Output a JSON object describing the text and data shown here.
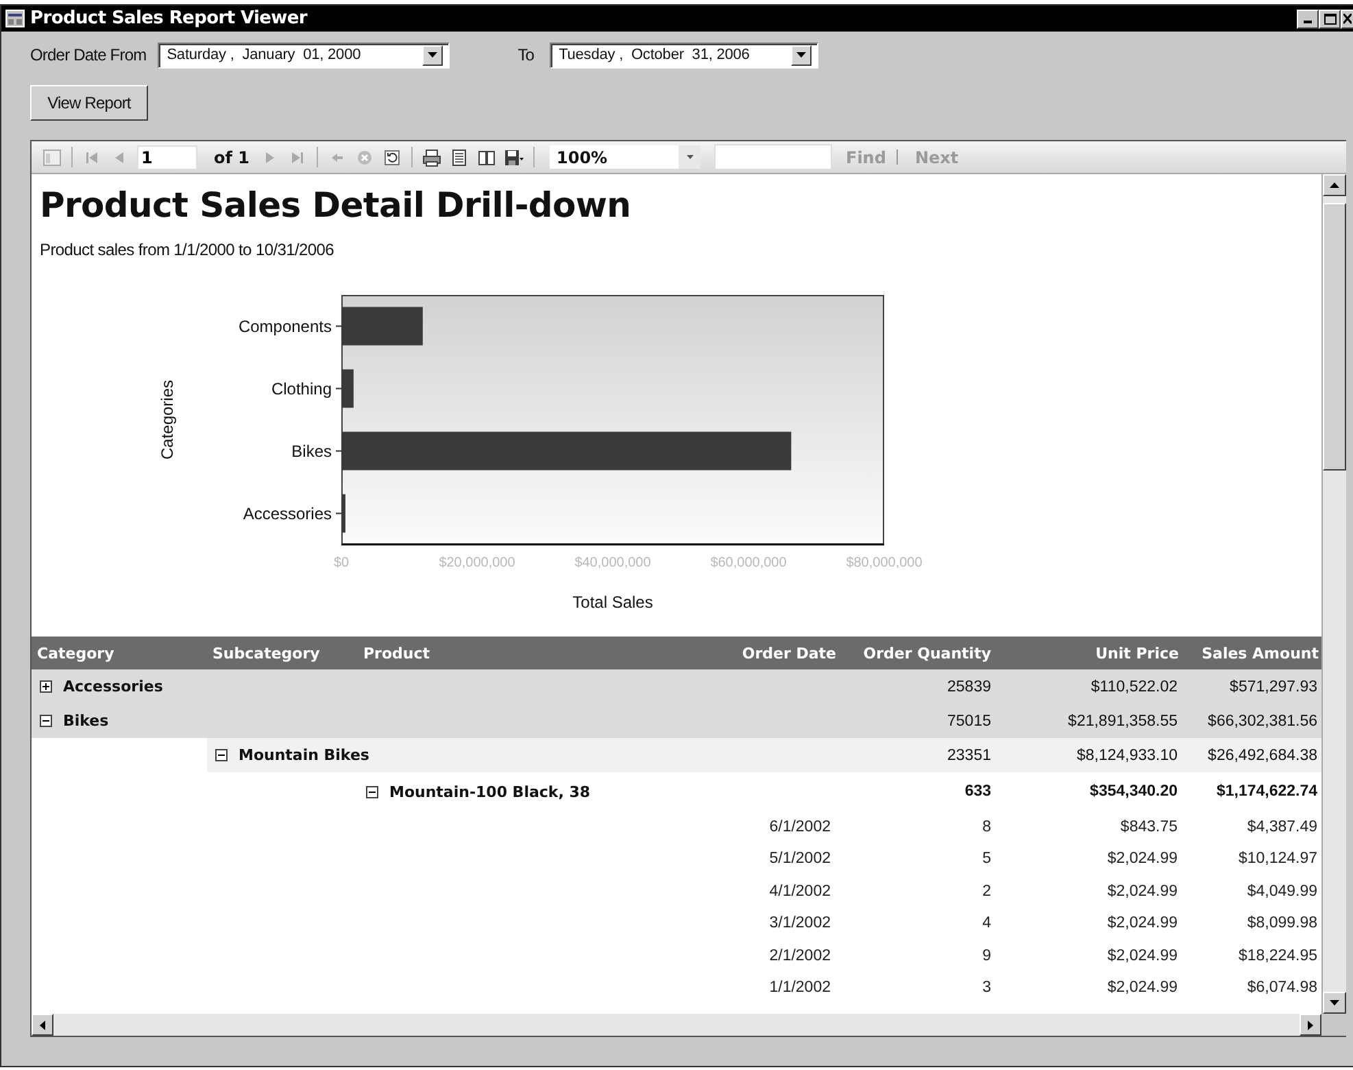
{
  "window": {
    "title": "Product Sales Report Viewer"
  },
  "filters": {
    "from_label": "Order Date From",
    "from_value": "Saturday ,  January  01, 2000",
    "to_label": "To",
    "to_value": "Tuesday ,  October  31, 2006"
  },
  "view_button": "View Report",
  "toolbar": {
    "page": "1",
    "page_of": "of 1",
    "zoom": "100%",
    "find": "Find",
    "next": "Next",
    "find_disabled": true
  },
  "report": {
    "title": "Product Sales Detail Drill-down",
    "subtitle": "Product sales from 1/1/2000 to 10/31/2006",
    "chart_data": {
      "type": "bar",
      "orientation": "horizontal",
      "xlabel": "Total Sales",
      "ylabel": "Categories",
      "categories": [
        "Components",
        "Clothing",
        "Bikes",
        "Accessories"
      ],
      "series": [
        {
          "color": "#3a3a3a",
          "values": [
            12000000,
            1800000,
            66300000,
            600000
          ]
        }
      ],
      "xlim": [
        0,
        80000000
      ],
      "xticks": [
        {
          "value": 0,
          "label": "$0"
        },
        {
          "value": 20000000,
          "label": "$20,000,000"
        },
        {
          "value": 40000000,
          "label": "$40,000,000"
        },
        {
          "value": 60000000,
          "label": "$60,000,000"
        },
        {
          "value": 80000000,
          "label": "$80,000,000"
        }
      ]
    },
    "table": {
      "columns": [
        "Category",
        "Subcategory",
        "Product",
        "Order Date",
        "Order Quantity",
        "Unit Price",
        "Sales Amount"
      ],
      "rows": [
        {
          "kind": "category",
          "label": "Accessories",
          "expanded": false,
          "quantity": "25839",
          "unit_price": "$110,522.02",
          "sales_amount": "$571,297.93"
        },
        {
          "kind": "category",
          "label": "Bikes",
          "expanded": true,
          "quantity": "75015",
          "unit_price": "$21,891,358.55",
          "sales_amount": "$66,302,381.56",
          "children": [
            {
              "kind": "subcategory",
              "label": "Mountain Bikes",
              "expanded": true,
              "quantity": "23351",
              "unit_price": "$8,124,933.10",
              "sales_amount": "$26,492,684.38",
              "children": [
                {
                  "kind": "product",
                  "label": "Mountain-100 Black, 38",
                  "expanded": true,
                  "quantity": "633",
                  "unit_price": "$354,340.20",
                  "sales_amount": "$1,174,622.74",
                  "children": [
                    {
                      "kind": "detail",
                      "order_date": "6/1/2002",
                      "quantity": "8",
                      "unit_price": "$843.75",
                      "sales_amount": "$4,387.49"
                    },
                    {
                      "kind": "detail",
                      "order_date": "5/1/2002",
                      "quantity": "5",
                      "unit_price": "$2,024.99",
                      "sales_amount": "$10,124.97"
                    },
                    {
                      "kind": "detail",
                      "order_date": "4/1/2002",
                      "quantity": "2",
                      "unit_price": "$2,024.99",
                      "sales_amount": "$4,049.99"
                    },
                    {
                      "kind": "detail",
                      "order_date": "3/1/2002",
                      "quantity": "4",
                      "unit_price": "$2,024.99",
                      "sales_amount": "$8,099.98"
                    },
                    {
                      "kind": "detail",
                      "order_date": "2/1/2002",
                      "quantity": "9",
                      "unit_price": "$2,024.99",
                      "sales_amount": "$18,224.95"
                    },
                    {
                      "kind": "detail",
                      "order_date": "1/1/2002",
                      "quantity": "3",
                      "unit_price": "$2,024.99",
                      "sales_amount": "$6,074.98"
                    }
                  ]
                }
              ]
            }
          ]
        }
      ]
    }
  }
}
